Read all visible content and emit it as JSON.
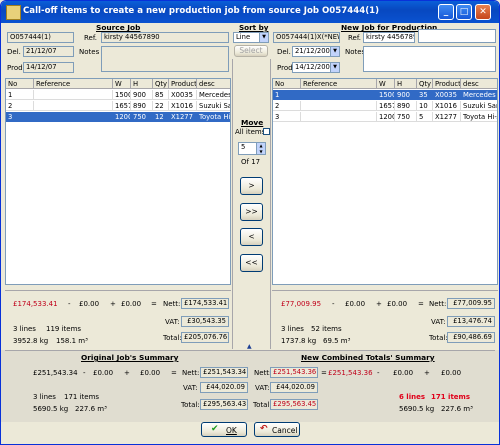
{
  "window": {
    "title": "Call-off items to create a new production job from source Job O057444(1)"
  },
  "source": {
    "header": "Source Job",
    "job_no": "O057444(1)",
    "ref_label": "Ref.",
    "ref_value": "kirsty 44567890",
    "del_label": "Del.",
    "del_value": "21/12/07",
    "notes_label": "Notes",
    "prod_label": "Prod.",
    "prod_value": "14/12/07",
    "columns": [
      "No",
      "Reference",
      "W",
      "H",
      "Qty",
      "Product",
      "desc"
    ],
    "rows": [
      [
        "1",
        "",
        "1500",
        "900",
        "85",
        "X0035",
        "Mercedes T"
      ],
      [
        "2",
        "",
        "1657",
        "890",
        "22",
        "X1016",
        "Suzuki Sam"
      ],
      [
        "3",
        "",
        "1200",
        "750",
        "12",
        "X1277",
        "Toyota Hi-A"
      ]
    ],
    "totals": {
      "first": "£174,533.41",
      "op_minus": "-",
      "second": "£0.00",
      "op_plus": "+",
      "third": "£0.00",
      "op_eq": "=",
      "nett_label": "Nett:",
      "nett": "£174,533.41",
      "vat_label": "VAT:",
      "vat": "£30,543.35",
      "total_label": "Total:",
      "total": "£205,076.76",
      "lines": "3 lines",
      "items": "119 items",
      "kg": "3952.8 kg",
      "m3": "158.1 m³"
    }
  },
  "middle": {
    "sort_by_label": "Sort by",
    "sort_value": "Line",
    "select_label": "Select",
    "move_label": "Move",
    "all_items_label": "All items",
    "qty_value": "5",
    "of_label": "Of 17",
    "btn_move_right": ">",
    "btn_move_all_right": ">>",
    "btn_move_left": "<",
    "btn_move_all_left": "<<"
  },
  "target": {
    "header": "New Job for Production",
    "job_no": "O057444(1)X(*NEW*",
    "ref_label": "Ref.",
    "ref_value": "kirsty 44567890",
    "del_label": "Del.",
    "del_value": "21/12/2007",
    "notes_label": "Notes",
    "prod_label": "Prod.",
    "prod_value": "14/12/2007",
    "columns": [
      "No",
      "Reference",
      "W",
      "H",
      "Qty",
      "Product",
      "desc"
    ],
    "rows": [
      [
        "1",
        "",
        "1500",
        "900",
        "35",
        "X0035",
        "Mercedes T"
      ],
      [
        "2",
        "",
        "1657",
        "890",
        "10",
        "X1016",
        "Suzuki Sam"
      ],
      [
        "3",
        "",
        "1200",
        "750",
        "5",
        "X1277",
        "Toyota Hi-A"
      ]
    ],
    "totals": {
      "first": "£77,009.95",
      "op_minus": "-",
      "second": "£0.00",
      "op_plus": "+",
      "third": "£0.00",
      "op_eq": "=",
      "nett_label": "Nett:",
      "nett": "£77,009.95",
      "vat_label": "VAT:",
      "vat": "£13,476.74",
      "total_label": "Total:",
      "total": "£90,486.69",
      "lines": "3 lines",
      "items": "52 items",
      "kg": "1737.8 kg",
      "m3": "69.5 m³"
    }
  },
  "original_summary": {
    "header": "Original Job's Summary",
    "first": "£251,543.34",
    "op_minus": "-",
    "second": "£0.00",
    "op_plus": "+",
    "third": "£0.00",
    "op_eq": "=",
    "nett_label": "Nett:",
    "nett": "£251,543.34",
    "vat_label": "VAT:",
    "vat": "£44,020.09",
    "total_label": "Total:",
    "total": "£295,563.43",
    "lines": "3 lines",
    "items": "171 items",
    "kg": "5690.5 kg",
    "m3": "227.6 m³"
  },
  "combined_summary": {
    "header": "New Combined Totals' Summary",
    "nett_label": "Nett:",
    "nett": "£251,543.36",
    "op_eq": "=",
    "first": "£251,543.36",
    "op_minus": "-",
    "second": "£0.00",
    "op_plus": "+",
    "third": "£0.00",
    "vat_label": "VAT:",
    "vat": "£44,020.09",
    "total_label": "Total:",
    "total": "£295,563.45",
    "lines": "6 lines",
    "items": "171 items",
    "kg": "5690.5 kg",
    "m3": "227.6 m³"
  },
  "buttons": {
    "ok": "OK",
    "cancel": "Cancel"
  },
  "colors": {
    "selection": "#316ac5",
    "warning_red": "#c0001a",
    "title_blue": "#0a52d0"
  }
}
